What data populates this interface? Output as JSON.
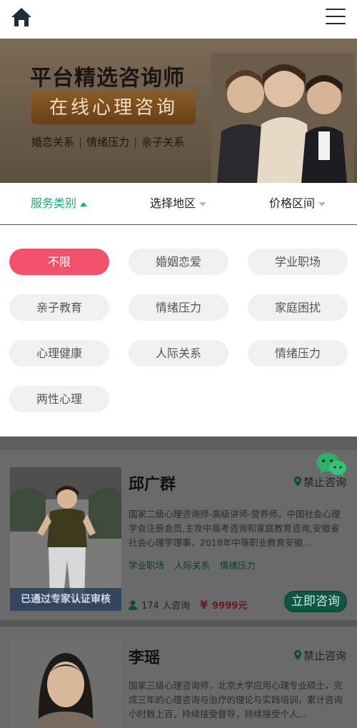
{
  "header": {
    "home_icon": "home-icon",
    "menu_icon": "hamburger-menu-icon"
  },
  "banner": {
    "title": "平台精选咨询师",
    "subtitle": "在线心理咨询",
    "tags": [
      "婚恋关系",
      "情绪压力",
      "亲子关系"
    ]
  },
  "filters": {
    "tabs": [
      {
        "label": "服务类别",
        "active": true
      },
      {
        "label": "选择地区",
        "active": false
      },
      {
        "label": "价格区间",
        "active": false
      }
    ]
  },
  "categories": [
    "不限",
    "婚姻恋爱",
    "学业职场",
    "亲子教育",
    "情绪压力",
    "家庭困扰",
    "心理健康",
    "人际关系",
    "情绪压力",
    "两性心理"
  ],
  "colors": {
    "accent": "#1aa67f",
    "active_chip": "#f2506b",
    "price": "#c0392b"
  },
  "counselors": [
    {
      "name": "邱广群",
      "location": "禁止咨询",
      "intro": "国家二级心理咨询师-高级讲师-营养师，中国社会心理学会注册会员,主攻中高考咨询和家庭教育咨询,安徽省社会心理学理事，2018年中等职业教育安徽...",
      "tags": [
        "学业职场",
        "人际关系",
        "情绪压力"
      ],
      "certified": "已通过专家认证审核",
      "consult_count": "174 人咨询",
      "price_symbol": "¥",
      "price": "9999元",
      "button": "立即咨询"
    },
    {
      "name": "李瑶",
      "location": "禁止咨询",
      "intro": "国家三级心理咨询师，北京大学应用心理专业硕士，完成三年的心理咨询与治疗的理论与实践培训，累计咨询小时数上百，持续接受督导，持续接受个人..."
    }
  ]
}
